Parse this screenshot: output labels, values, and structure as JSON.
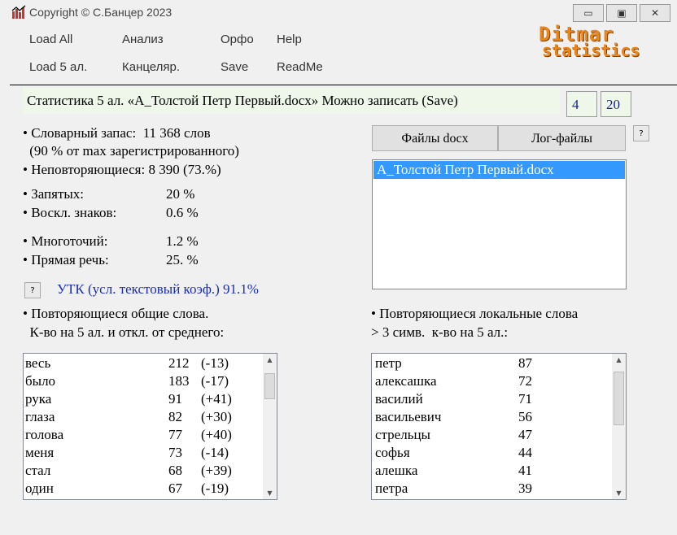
{
  "window": {
    "title": "Copyright © С.Банцер 2023",
    "minimize": "▭",
    "maximize": "▣",
    "close": "✕"
  },
  "menu": {
    "row1": [
      "Load All",
      "Анализ",
      "Орфо",
      "Help"
    ],
    "row2": [
      "Load 5 ал.",
      "Канцеляр.",
      "Save",
      "ReadMe"
    ]
  },
  "logo": {
    "line1": "Ditmar",
    "line2": "statistics"
  },
  "status": {
    "text": "Статистика 5 ал.  «А_Толстой Петр Первый.docx» Можно записать (Save)",
    "box1": "4",
    "box2": "20"
  },
  "stats": {
    "vocab": "• Словарный запас:  11 368 слов",
    "vocab_note": " (90 % от max зарегистрированного)",
    "unique": "• Неповторяющиеся: 8 390 (73.%)",
    "items": [
      {
        "label": "• Запятых:",
        "value": "20 %"
      },
      {
        "label": "• Воскл. знаков:",
        "value": "0.6 %"
      },
      {
        "label": "• Многоточий:",
        "value": "1.2 %"
      },
      {
        "label": "• Прямая речь:",
        "value": "25. %"
      }
    ],
    "help": "?",
    "utk": "УТК (усл. текстовый коэф.) 91.1%"
  },
  "buttons": {
    "docx": "Файлы docx",
    "logs": "Лог-файлы",
    "help": "?"
  },
  "files": [
    "А_Толстой Петр Первый.docx"
  ],
  "common": {
    "title1": "• Повторяющиеся общие слова.",
    "title2": "  К-во на 5 ал. и откл. от среднего:",
    "rows": [
      [
        "весь",
        "212",
        "(-13)"
      ],
      [
        "было",
        "183",
        "(-17)"
      ],
      [
        "рука",
        "91",
        "(+41)"
      ],
      [
        "глаза",
        "82",
        "(+30)"
      ],
      [
        "голова",
        "77",
        "(+40)"
      ],
      [
        "меня",
        "73",
        "(-14)"
      ],
      [
        "стал",
        "68",
        "(+39)"
      ],
      [
        "один",
        "67",
        "(-19)"
      ]
    ]
  },
  "local": {
    "title1": "• Повторяющиеся локальные слова",
    "title2": "> 3 симв.  к-во на 5 ал.:",
    "rows": [
      [
        "петр",
        "87"
      ],
      [
        "алексашка",
        "72"
      ],
      [
        "василий",
        "71"
      ],
      [
        "васильевич",
        "56"
      ],
      [
        "стрельцы",
        "47"
      ],
      [
        "софья",
        "44"
      ],
      [
        "алешка",
        "41"
      ],
      [
        "петра",
        "39"
      ]
    ]
  }
}
